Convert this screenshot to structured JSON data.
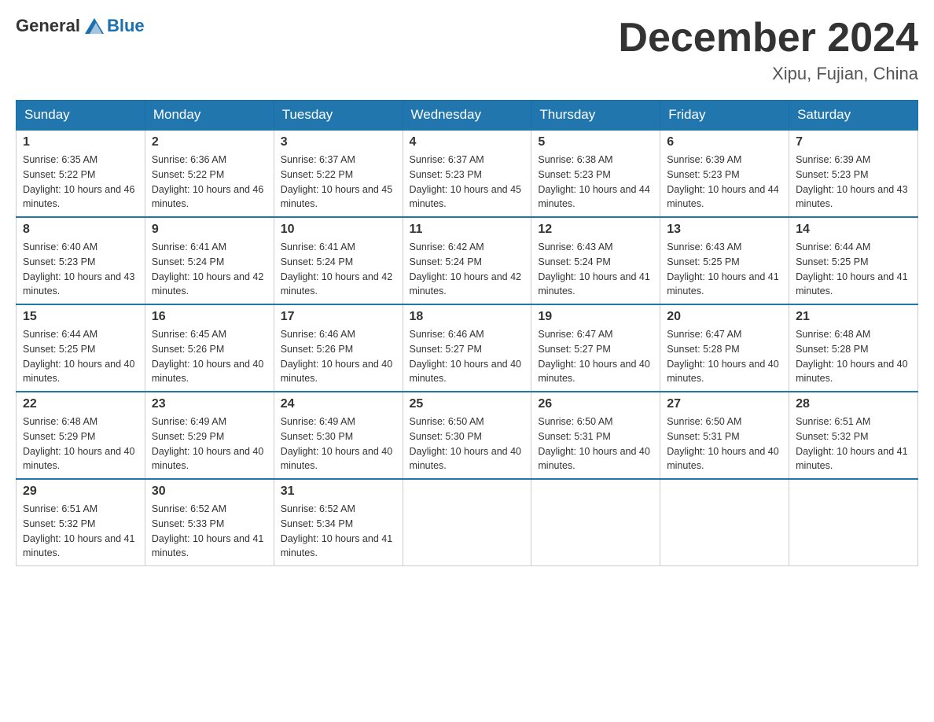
{
  "header": {
    "logo_general": "General",
    "logo_blue": "Blue",
    "month_title": "December 2024",
    "location": "Xipu, Fujian, China"
  },
  "weekdays": [
    "Sunday",
    "Monday",
    "Tuesday",
    "Wednesday",
    "Thursday",
    "Friday",
    "Saturday"
  ],
  "weeks": [
    [
      {
        "day": "1",
        "sunrise": "6:35 AM",
        "sunset": "5:22 PM",
        "daylight": "10 hours and 46 minutes."
      },
      {
        "day": "2",
        "sunrise": "6:36 AM",
        "sunset": "5:22 PM",
        "daylight": "10 hours and 46 minutes."
      },
      {
        "day": "3",
        "sunrise": "6:37 AM",
        "sunset": "5:22 PM",
        "daylight": "10 hours and 45 minutes."
      },
      {
        "day": "4",
        "sunrise": "6:37 AM",
        "sunset": "5:23 PM",
        "daylight": "10 hours and 45 minutes."
      },
      {
        "day": "5",
        "sunrise": "6:38 AM",
        "sunset": "5:23 PM",
        "daylight": "10 hours and 44 minutes."
      },
      {
        "day": "6",
        "sunrise": "6:39 AM",
        "sunset": "5:23 PM",
        "daylight": "10 hours and 44 minutes."
      },
      {
        "day": "7",
        "sunrise": "6:39 AM",
        "sunset": "5:23 PM",
        "daylight": "10 hours and 43 minutes."
      }
    ],
    [
      {
        "day": "8",
        "sunrise": "6:40 AM",
        "sunset": "5:23 PM",
        "daylight": "10 hours and 43 minutes."
      },
      {
        "day": "9",
        "sunrise": "6:41 AM",
        "sunset": "5:24 PM",
        "daylight": "10 hours and 42 minutes."
      },
      {
        "day": "10",
        "sunrise": "6:41 AM",
        "sunset": "5:24 PM",
        "daylight": "10 hours and 42 minutes."
      },
      {
        "day": "11",
        "sunrise": "6:42 AM",
        "sunset": "5:24 PM",
        "daylight": "10 hours and 42 minutes."
      },
      {
        "day": "12",
        "sunrise": "6:43 AM",
        "sunset": "5:24 PM",
        "daylight": "10 hours and 41 minutes."
      },
      {
        "day": "13",
        "sunrise": "6:43 AM",
        "sunset": "5:25 PM",
        "daylight": "10 hours and 41 minutes."
      },
      {
        "day": "14",
        "sunrise": "6:44 AM",
        "sunset": "5:25 PM",
        "daylight": "10 hours and 41 minutes."
      }
    ],
    [
      {
        "day": "15",
        "sunrise": "6:44 AM",
        "sunset": "5:25 PM",
        "daylight": "10 hours and 40 minutes."
      },
      {
        "day": "16",
        "sunrise": "6:45 AM",
        "sunset": "5:26 PM",
        "daylight": "10 hours and 40 minutes."
      },
      {
        "day": "17",
        "sunrise": "6:46 AM",
        "sunset": "5:26 PM",
        "daylight": "10 hours and 40 minutes."
      },
      {
        "day": "18",
        "sunrise": "6:46 AM",
        "sunset": "5:27 PM",
        "daylight": "10 hours and 40 minutes."
      },
      {
        "day": "19",
        "sunrise": "6:47 AM",
        "sunset": "5:27 PM",
        "daylight": "10 hours and 40 minutes."
      },
      {
        "day": "20",
        "sunrise": "6:47 AM",
        "sunset": "5:28 PM",
        "daylight": "10 hours and 40 minutes."
      },
      {
        "day": "21",
        "sunrise": "6:48 AM",
        "sunset": "5:28 PM",
        "daylight": "10 hours and 40 minutes."
      }
    ],
    [
      {
        "day": "22",
        "sunrise": "6:48 AM",
        "sunset": "5:29 PM",
        "daylight": "10 hours and 40 minutes."
      },
      {
        "day": "23",
        "sunrise": "6:49 AM",
        "sunset": "5:29 PM",
        "daylight": "10 hours and 40 minutes."
      },
      {
        "day": "24",
        "sunrise": "6:49 AM",
        "sunset": "5:30 PM",
        "daylight": "10 hours and 40 minutes."
      },
      {
        "day": "25",
        "sunrise": "6:50 AM",
        "sunset": "5:30 PM",
        "daylight": "10 hours and 40 minutes."
      },
      {
        "day": "26",
        "sunrise": "6:50 AM",
        "sunset": "5:31 PM",
        "daylight": "10 hours and 40 minutes."
      },
      {
        "day": "27",
        "sunrise": "6:50 AM",
        "sunset": "5:31 PM",
        "daylight": "10 hours and 40 minutes."
      },
      {
        "day": "28",
        "sunrise": "6:51 AM",
        "sunset": "5:32 PM",
        "daylight": "10 hours and 41 minutes."
      }
    ],
    [
      {
        "day": "29",
        "sunrise": "6:51 AM",
        "sunset": "5:32 PM",
        "daylight": "10 hours and 41 minutes."
      },
      {
        "day": "30",
        "sunrise": "6:52 AM",
        "sunset": "5:33 PM",
        "daylight": "10 hours and 41 minutes."
      },
      {
        "day": "31",
        "sunrise": "6:52 AM",
        "sunset": "5:34 PM",
        "daylight": "10 hours and 41 minutes."
      },
      null,
      null,
      null,
      null
    ]
  ]
}
